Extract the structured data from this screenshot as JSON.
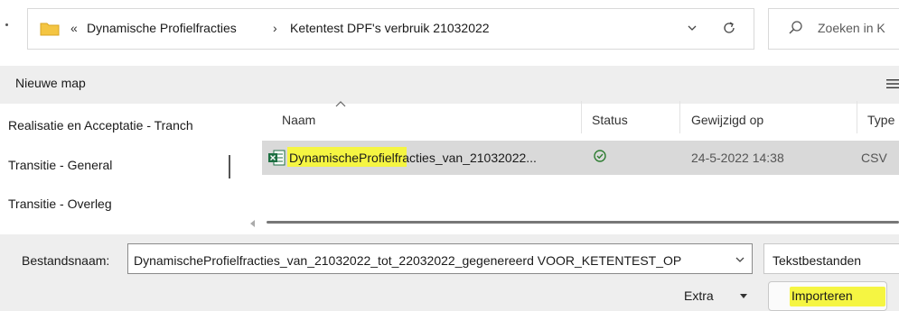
{
  "address_bar": {
    "overflow_glyph": "«",
    "crumbs": [
      "Dynamische Profielfracties",
      "Ketentest DPF's verbruik 21032022"
    ],
    "separator": "›",
    "icons": [
      "folder-icon",
      "chevron-down-icon",
      "refresh-icon"
    ]
  },
  "search": {
    "placeholder": "Zoeken in K",
    "icon": "search-icon"
  },
  "toolbar": {
    "new_folder_label": "Nieuwe map",
    "menu_icon": "hamburger-menu-icon"
  },
  "nav_pane": {
    "items": [
      {
        "label": "Realisatie en Acceptatie - Tranch"
      },
      {
        "label": "Transitie - General"
      },
      {
        "label": "Transitie - Overleg"
      }
    ]
  },
  "file_list": {
    "columns": [
      "Naam",
      "Status",
      "Gewijzigd op",
      "Type"
    ],
    "rows": [
      {
        "name": "DynamischeProfielfracties_van_21032022...",
        "status_icon": "synced-check-icon",
        "modified": "24-5-2022 14:38",
        "type": "CSV",
        "file_icon": "excel-csv-icon"
      }
    ]
  },
  "footer": {
    "filename_label": "Bestandsnaam:",
    "filename_value": "DynamischeProfielfracties_van_21032022_tot_22032022_gegenereerd VOOR_KETENTEST_OP",
    "filetype_value": "Tekstbestanden",
    "extra_label": "Extra",
    "import_label": "Importeren"
  },
  "colors": {
    "highlight": "#f5f542",
    "selected_row": "#d9d9d9",
    "status_green": "#2e7d32",
    "excel_green": "#1d6f42",
    "folder_yellow": "#f4c542"
  }
}
